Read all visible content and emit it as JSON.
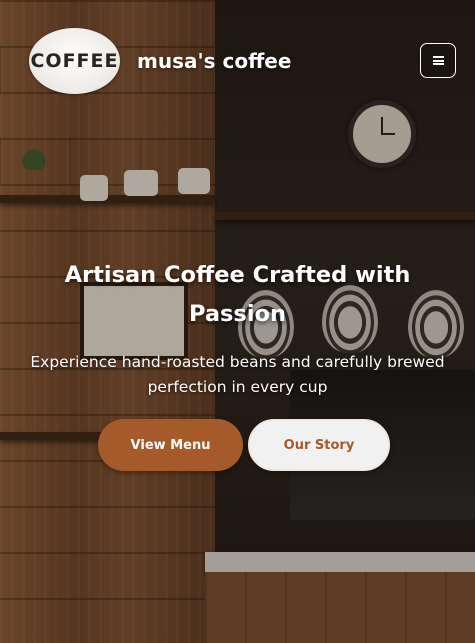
{
  "header": {
    "logo_text": "COFFEE",
    "brand_name": "musa's coffee",
    "menu_icon": "hamburger-icon"
  },
  "hero": {
    "title": "Artisan Coffee Crafted with Passion",
    "subtitle": "Experience hand-roasted beans and carefully brewed perfection in every cup",
    "primary_button_label": "View Menu",
    "secondary_button_label": "Our Story"
  },
  "colors": {
    "accent": "#a65a2b",
    "text": "#ffffff",
    "secondary_button_bg": "#ffffff"
  }
}
